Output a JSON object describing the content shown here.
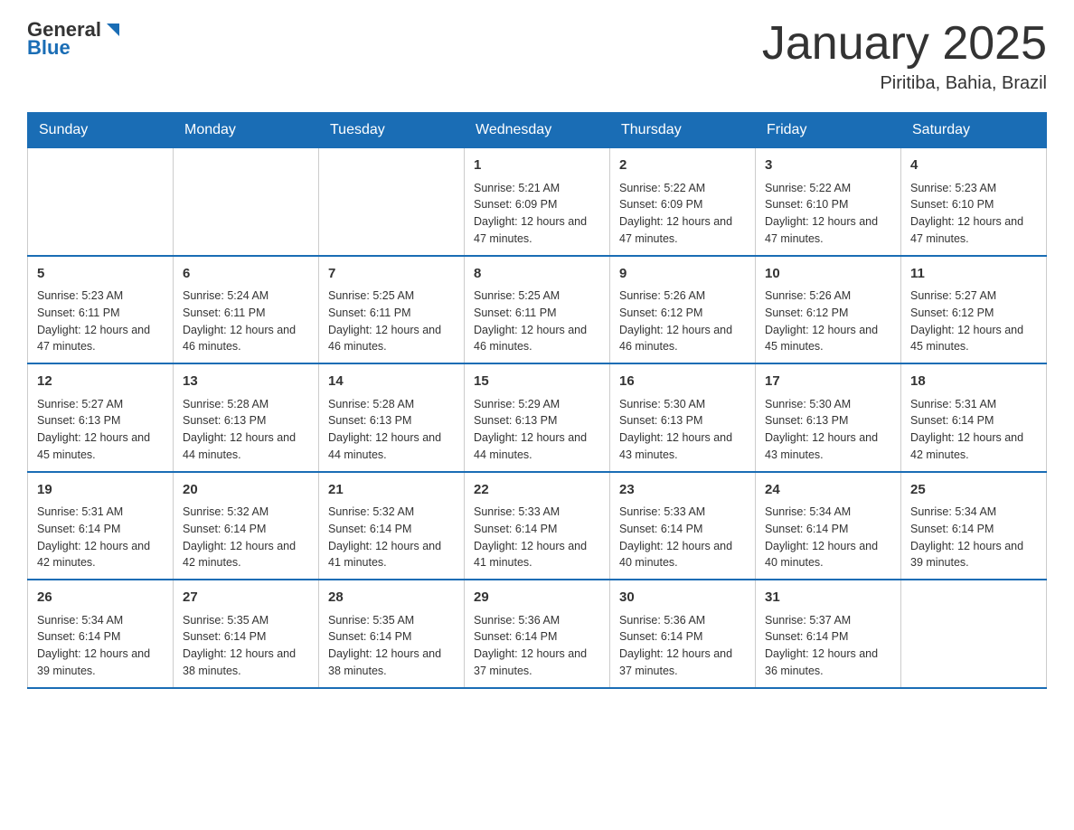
{
  "logo": {
    "general": "General",
    "blue": "Blue"
  },
  "title": "January 2025",
  "location": "Piritiba, Bahia, Brazil",
  "days_of_week": [
    "Sunday",
    "Monday",
    "Tuesday",
    "Wednesday",
    "Thursday",
    "Friday",
    "Saturday"
  ],
  "weeks": [
    [
      {
        "day": "",
        "info": ""
      },
      {
        "day": "",
        "info": ""
      },
      {
        "day": "",
        "info": ""
      },
      {
        "day": "1",
        "info": "Sunrise: 5:21 AM\nSunset: 6:09 PM\nDaylight: 12 hours and 47 minutes."
      },
      {
        "day": "2",
        "info": "Sunrise: 5:22 AM\nSunset: 6:09 PM\nDaylight: 12 hours and 47 minutes."
      },
      {
        "day": "3",
        "info": "Sunrise: 5:22 AM\nSunset: 6:10 PM\nDaylight: 12 hours and 47 minutes."
      },
      {
        "day": "4",
        "info": "Sunrise: 5:23 AM\nSunset: 6:10 PM\nDaylight: 12 hours and 47 minutes."
      }
    ],
    [
      {
        "day": "5",
        "info": "Sunrise: 5:23 AM\nSunset: 6:11 PM\nDaylight: 12 hours and 47 minutes."
      },
      {
        "day": "6",
        "info": "Sunrise: 5:24 AM\nSunset: 6:11 PM\nDaylight: 12 hours and 46 minutes."
      },
      {
        "day": "7",
        "info": "Sunrise: 5:25 AM\nSunset: 6:11 PM\nDaylight: 12 hours and 46 minutes."
      },
      {
        "day": "8",
        "info": "Sunrise: 5:25 AM\nSunset: 6:11 PM\nDaylight: 12 hours and 46 minutes."
      },
      {
        "day": "9",
        "info": "Sunrise: 5:26 AM\nSunset: 6:12 PM\nDaylight: 12 hours and 46 minutes."
      },
      {
        "day": "10",
        "info": "Sunrise: 5:26 AM\nSunset: 6:12 PM\nDaylight: 12 hours and 45 minutes."
      },
      {
        "day": "11",
        "info": "Sunrise: 5:27 AM\nSunset: 6:12 PM\nDaylight: 12 hours and 45 minutes."
      }
    ],
    [
      {
        "day": "12",
        "info": "Sunrise: 5:27 AM\nSunset: 6:13 PM\nDaylight: 12 hours and 45 minutes."
      },
      {
        "day": "13",
        "info": "Sunrise: 5:28 AM\nSunset: 6:13 PM\nDaylight: 12 hours and 44 minutes."
      },
      {
        "day": "14",
        "info": "Sunrise: 5:28 AM\nSunset: 6:13 PM\nDaylight: 12 hours and 44 minutes."
      },
      {
        "day": "15",
        "info": "Sunrise: 5:29 AM\nSunset: 6:13 PM\nDaylight: 12 hours and 44 minutes."
      },
      {
        "day": "16",
        "info": "Sunrise: 5:30 AM\nSunset: 6:13 PM\nDaylight: 12 hours and 43 minutes."
      },
      {
        "day": "17",
        "info": "Sunrise: 5:30 AM\nSunset: 6:13 PM\nDaylight: 12 hours and 43 minutes."
      },
      {
        "day": "18",
        "info": "Sunrise: 5:31 AM\nSunset: 6:14 PM\nDaylight: 12 hours and 42 minutes."
      }
    ],
    [
      {
        "day": "19",
        "info": "Sunrise: 5:31 AM\nSunset: 6:14 PM\nDaylight: 12 hours and 42 minutes."
      },
      {
        "day": "20",
        "info": "Sunrise: 5:32 AM\nSunset: 6:14 PM\nDaylight: 12 hours and 42 minutes."
      },
      {
        "day": "21",
        "info": "Sunrise: 5:32 AM\nSunset: 6:14 PM\nDaylight: 12 hours and 41 minutes."
      },
      {
        "day": "22",
        "info": "Sunrise: 5:33 AM\nSunset: 6:14 PM\nDaylight: 12 hours and 41 minutes."
      },
      {
        "day": "23",
        "info": "Sunrise: 5:33 AM\nSunset: 6:14 PM\nDaylight: 12 hours and 40 minutes."
      },
      {
        "day": "24",
        "info": "Sunrise: 5:34 AM\nSunset: 6:14 PM\nDaylight: 12 hours and 40 minutes."
      },
      {
        "day": "25",
        "info": "Sunrise: 5:34 AM\nSunset: 6:14 PM\nDaylight: 12 hours and 39 minutes."
      }
    ],
    [
      {
        "day": "26",
        "info": "Sunrise: 5:34 AM\nSunset: 6:14 PM\nDaylight: 12 hours and 39 minutes."
      },
      {
        "day": "27",
        "info": "Sunrise: 5:35 AM\nSunset: 6:14 PM\nDaylight: 12 hours and 38 minutes."
      },
      {
        "day": "28",
        "info": "Sunrise: 5:35 AM\nSunset: 6:14 PM\nDaylight: 12 hours and 38 minutes."
      },
      {
        "day": "29",
        "info": "Sunrise: 5:36 AM\nSunset: 6:14 PM\nDaylight: 12 hours and 37 minutes."
      },
      {
        "day": "30",
        "info": "Sunrise: 5:36 AM\nSunset: 6:14 PM\nDaylight: 12 hours and 37 minutes."
      },
      {
        "day": "31",
        "info": "Sunrise: 5:37 AM\nSunset: 6:14 PM\nDaylight: 12 hours and 36 minutes."
      },
      {
        "day": "",
        "info": ""
      }
    ]
  ]
}
